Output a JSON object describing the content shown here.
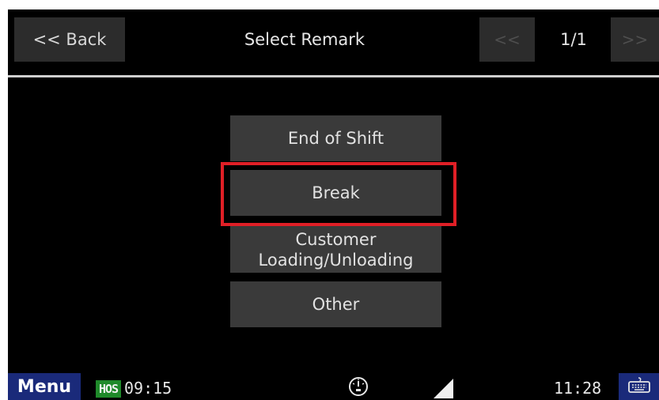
{
  "header": {
    "back_label": "<< Back",
    "title": "Select Remark",
    "prev_label": "<<",
    "page_indicator": "1/1",
    "next_label": ">>"
  },
  "options": [
    {
      "label": "End of Shift"
    },
    {
      "label": "Break",
      "highlighted": true
    },
    {
      "label": "Customer Loading/Unloading"
    },
    {
      "label": "Other"
    }
  ],
  "statusbar": {
    "menu_label": "Menu",
    "hos_badge": "HOS",
    "hos_time": "09:15",
    "clock": "11:28",
    "icons": [
      "speedometer-icon",
      "signal-icon",
      "keyboard-icon"
    ]
  },
  "colors": {
    "highlight": "#e01f26",
    "menu_bg": "#1a2a7a",
    "hos_badge_bg": "#1f8a2a",
    "button_bg": "#3a3a3a"
  }
}
